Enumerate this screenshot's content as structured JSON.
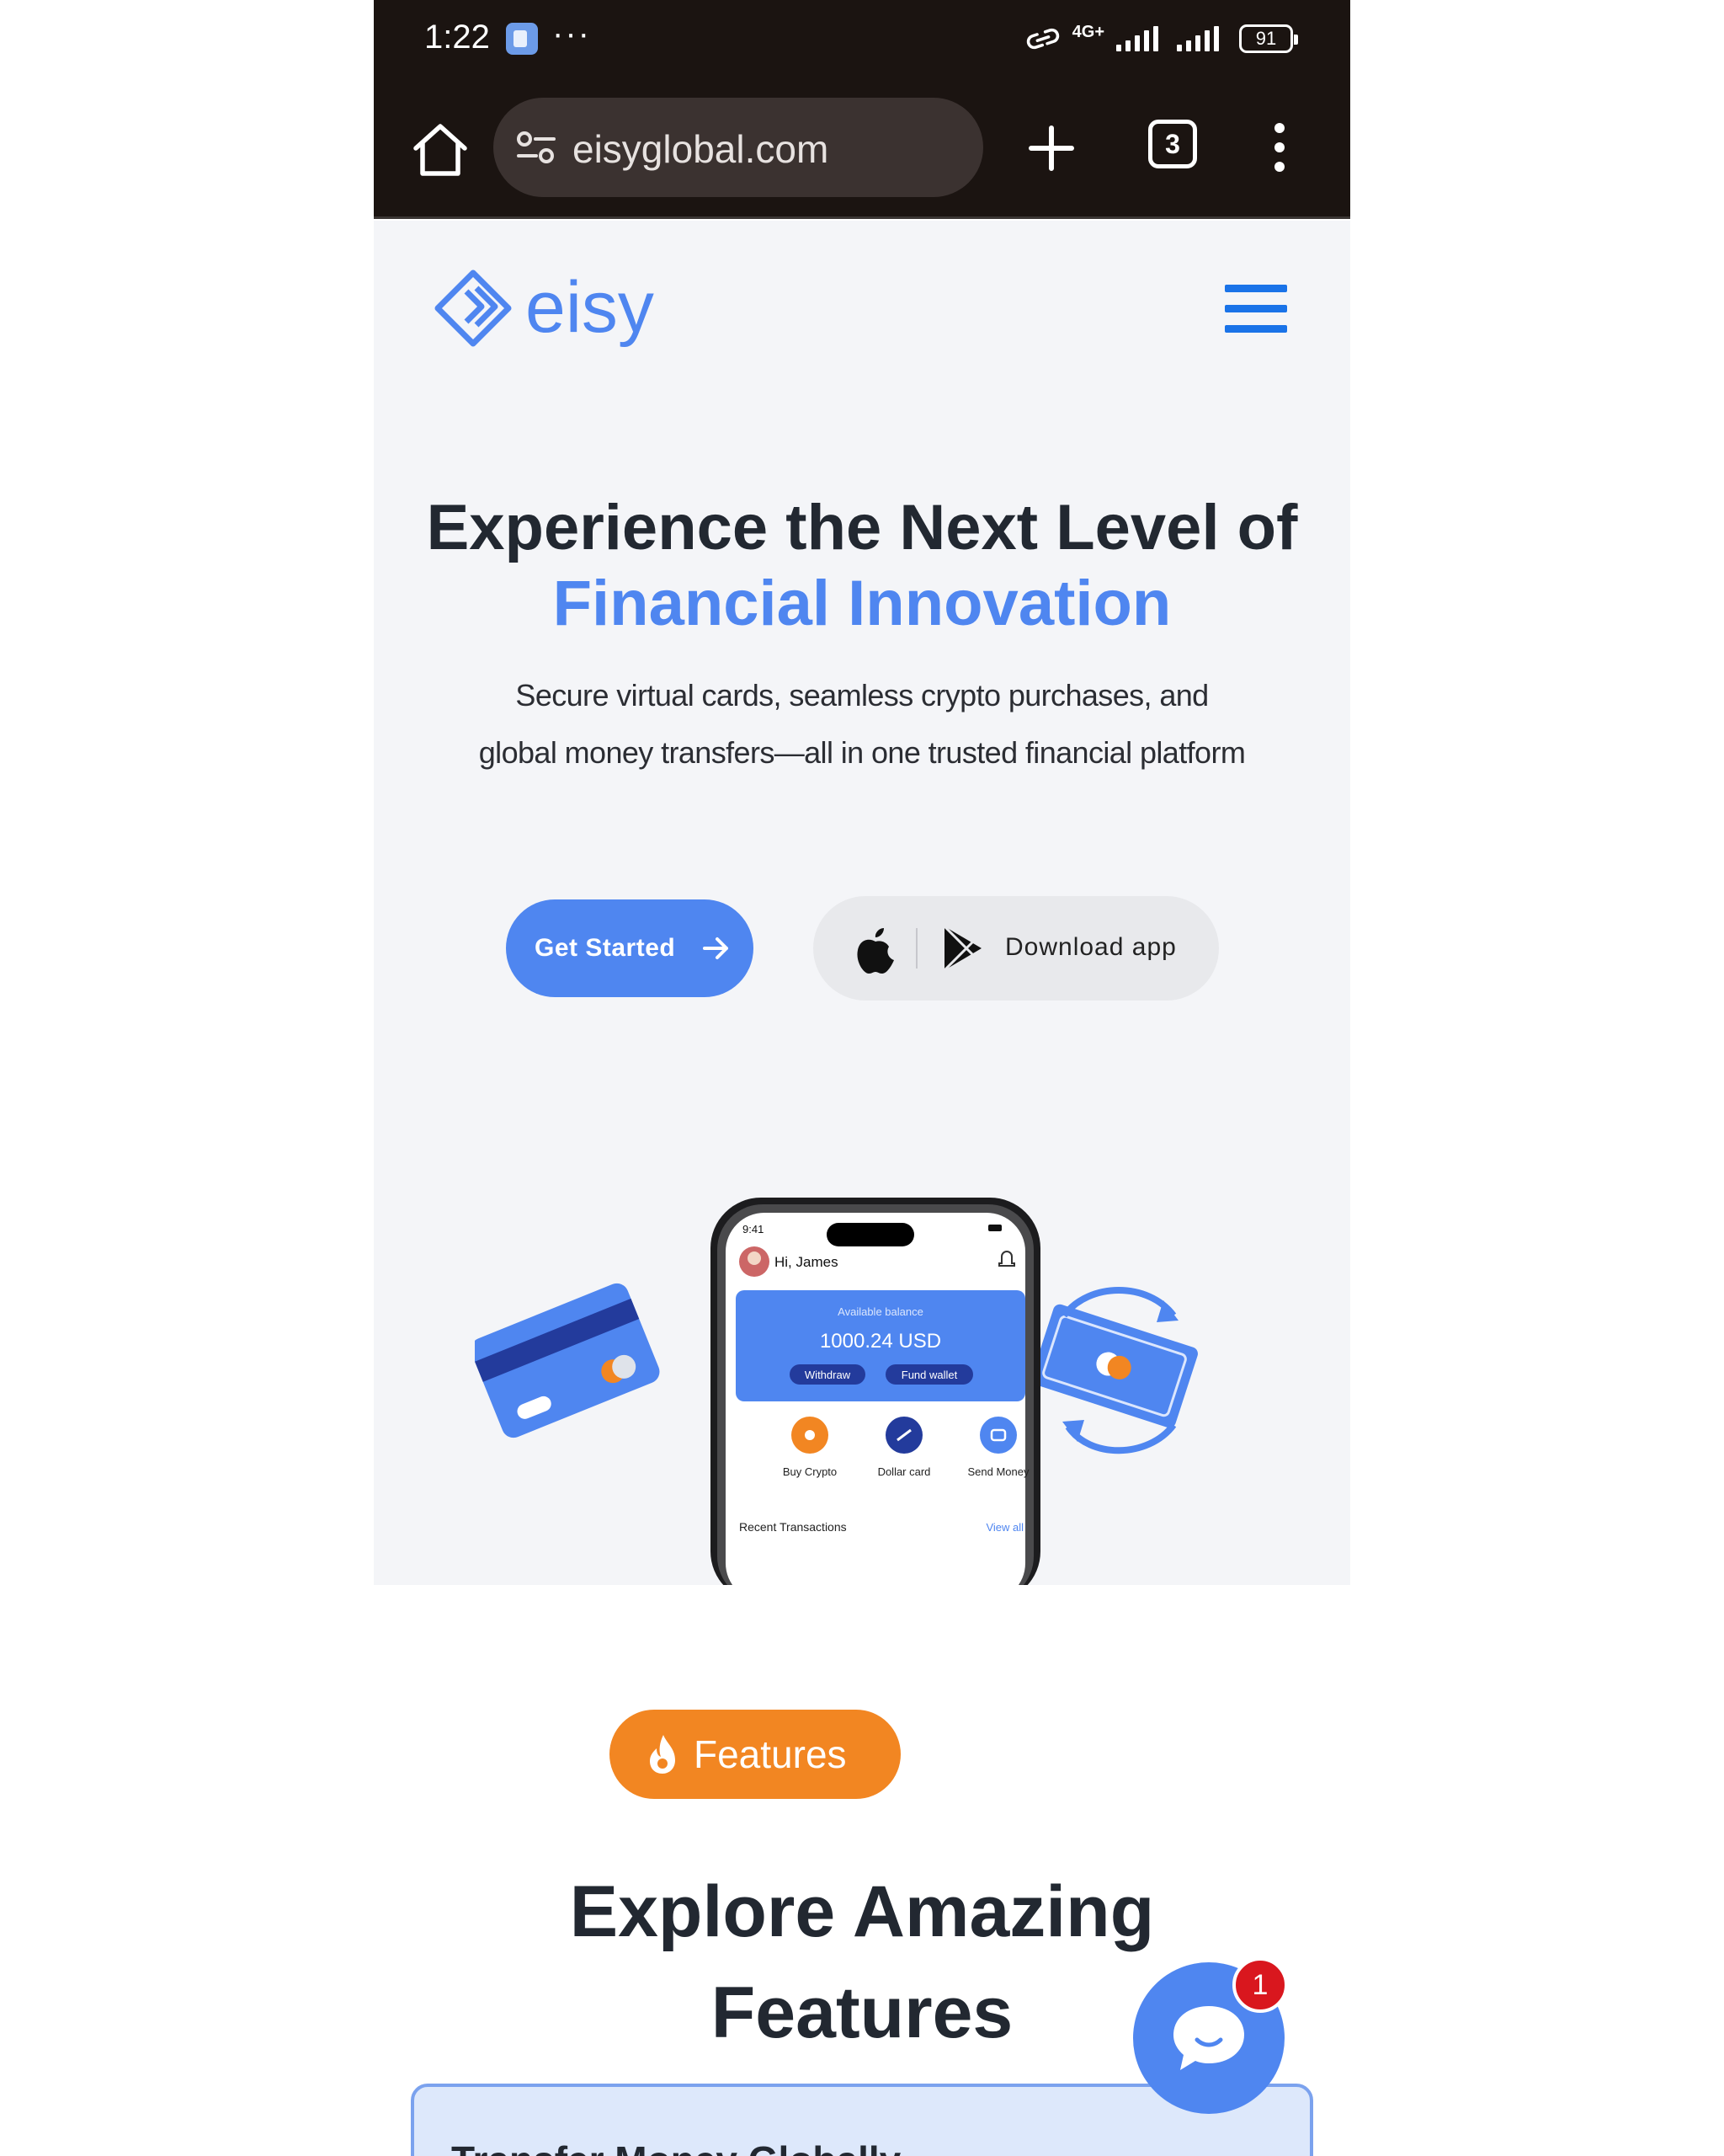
{
  "status_bar": {
    "time": "1:22",
    "dots": "···",
    "network": "4G+",
    "battery": "91"
  },
  "browser": {
    "url": "eisyglobal.com",
    "tab_count": "3"
  },
  "site": {
    "brand": "eisy",
    "brand_color": "#4f86f0",
    "hero": {
      "title_line1": "Experience the Next Level of",
      "title_line2": "Financial Innovation",
      "subtitle_line1": "Secure virtual cards, seamless crypto purchases, and",
      "subtitle_line2": "global money transfers—all in one trusted financial platform"
    },
    "buttons": {
      "get_started": "Get Started",
      "download_app": "Download app"
    },
    "phone_mock": {
      "time": "9:41",
      "greeting": "Hi, James",
      "balance_label": "Available balance",
      "balance_value": "1000.24 USD",
      "withdraw": "Withdraw",
      "fund_wallet": "Fund wallet",
      "actions": [
        "Buy Crypto",
        "Dollar card",
        "Send Money"
      ],
      "recent": "Recent Transactions",
      "view_all": "View all"
    },
    "features": {
      "pill": "Features",
      "pill_color": "#f28622",
      "title_line1": "Explore Amazing",
      "title_line2": "Features",
      "card_title": "Transfer Money Globally"
    },
    "chat": {
      "badge": "1"
    }
  }
}
